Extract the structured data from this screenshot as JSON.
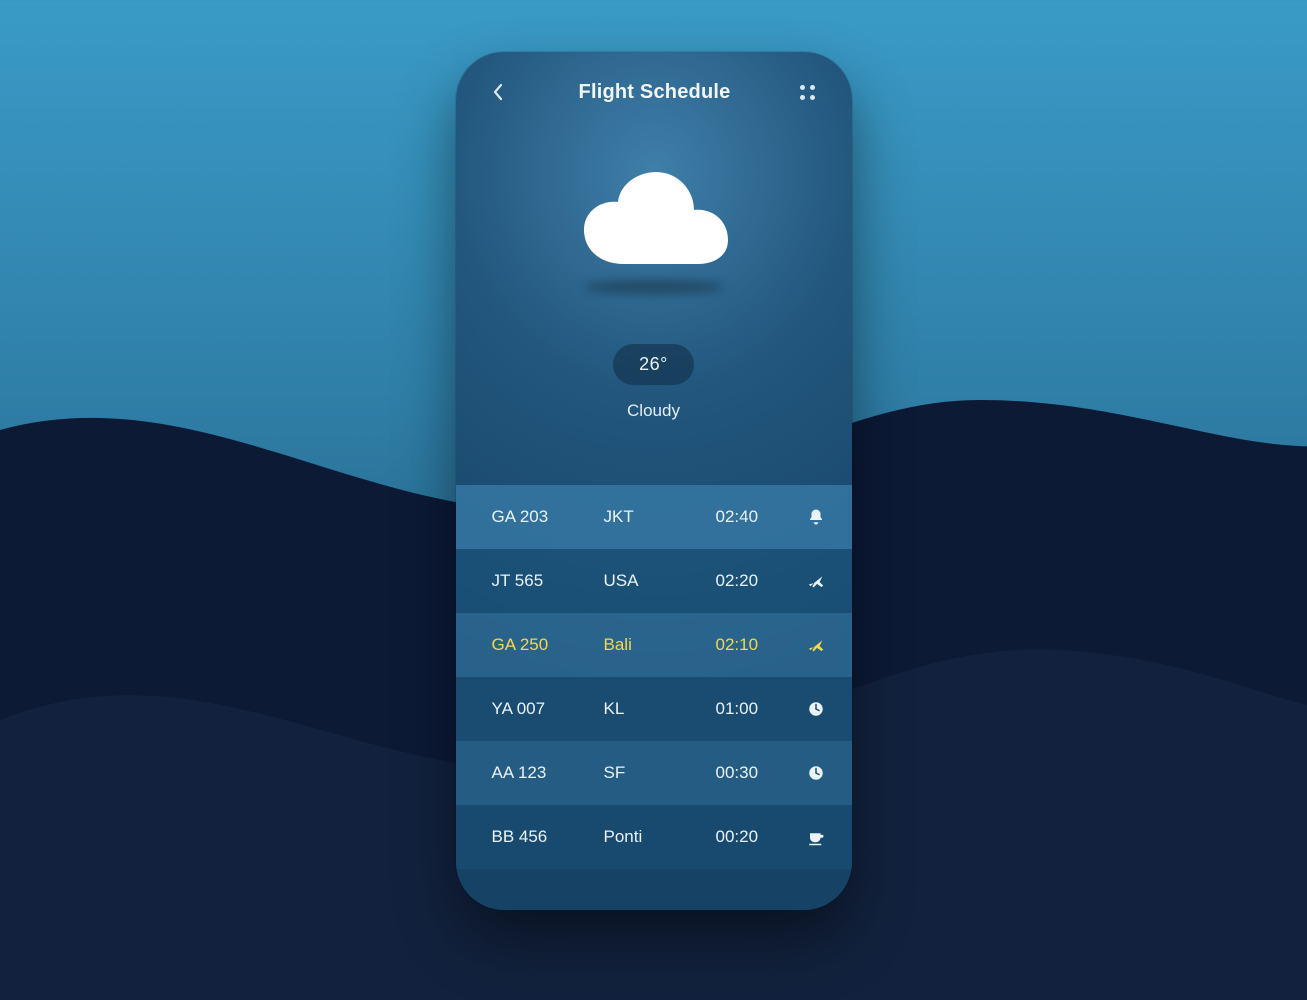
{
  "header": {
    "title": "Flight Schedule"
  },
  "weather": {
    "temperature": "26°",
    "condition": "Cloudy"
  },
  "flights": [
    {
      "code": "GA 203",
      "dest": "JKT",
      "time": "02:40",
      "status_icon": "bell",
      "highlight": false
    },
    {
      "code": "JT 565",
      "dest": "USA",
      "time": "02:20",
      "status_icon": "plane",
      "highlight": false
    },
    {
      "code": "GA 250",
      "dest": "Bali",
      "time": "02:10",
      "status_icon": "plane",
      "highlight": true
    },
    {
      "code": "YA 007",
      "dest": "KL",
      "time": "01:00",
      "status_icon": "clock",
      "highlight": false
    },
    {
      "code": "AA 123",
      "dest": "SF",
      "time": "00:30",
      "status_icon": "clock",
      "highlight": false
    },
    {
      "code": "BB 456",
      "dest": "Ponti",
      "time": "00:20",
      "status_icon": "cup",
      "highlight": false
    }
  ],
  "colors": {
    "accent": "#f5d74a",
    "text": "#e9f3f9"
  }
}
